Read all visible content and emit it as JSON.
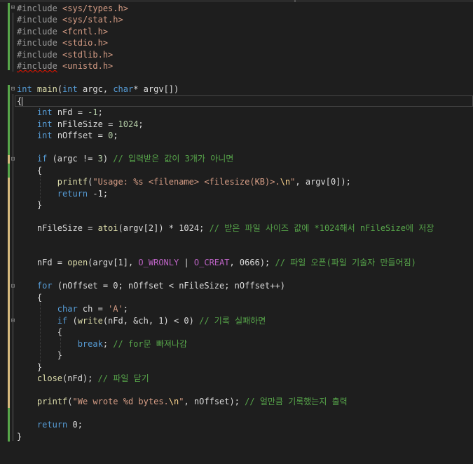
{
  "colors": {
    "background": "#1e1e1e",
    "keyword": "#569cd6",
    "string": "#d69d85",
    "comment": "#57a64a",
    "function": "#dcdcaa",
    "number": "#b5cea8",
    "variable": "#9cdcfe",
    "macro": "#bd63c5"
  },
  "code": {
    "includes": [
      {
        "directive": "#include",
        "header": "<sys/types.h>"
      },
      {
        "directive": "#include",
        "header": "<sys/stat.h>"
      },
      {
        "directive": "#include",
        "header": "<fcntl.h>"
      },
      {
        "directive": "#include",
        "header": "<stdio.h>"
      },
      {
        "directive": "#include",
        "header": "<stdlib.h>"
      },
      {
        "directive": "#include",
        "header": "<unistd.h>"
      }
    ],
    "main_signature": {
      "int": "int",
      "name": "main",
      "open": "(",
      "int2": "int",
      "p1": " argc, ",
      "char": "char",
      "p2": "* argv[])"
    },
    "open_brace": "{",
    "decl_fd": {
      "kw": "int",
      "rest": " nFd = ",
      "val": "-1",
      "end": ";"
    },
    "decl_size": {
      "kw": "int",
      "rest": " nFileSize = ",
      "val": "1024",
      "end": ";"
    },
    "decl_offset": {
      "kw": "int",
      "rest": " nOffset = ",
      "val": "0",
      "end": ";"
    },
    "if_argc": {
      "kw": "if",
      "rest": " (argc != ",
      "val": "3",
      "close": ") ",
      "comment": "// 입력받은 값이 3개가 아니면"
    },
    "if_open": "{",
    "printf_usage": {
      "fn": "printf",
      "open": "(",
      "str1": "\"Usage: %s <filename> <filesize(KB)>.",
      "esc": "\\n",
      "str2": "\"",
      "rest": ", argv[0]);"
    },
    "return_neg": {
      "kw": "return",
      "rest": " -1;"
    },
    "if_close": "}",
    "atoi_line": {
      "lhs": "nFileSize = ",
      "fn": "atoi",
      "rest": "(argv[2]) * 1024; ",
      "comment": "// 받은 파일 사이즈 값에 *1024해서 nFileSize에 저장"
    },
    "open_line": {
      "lhs": "nFd = ",
      "fn": "open",
      "p1": "(argv[1], ",
      "m1": "O_WRONLY",
      "p2": " | ",
      "m2": "O_CREAT",
      "p3": ", 0666); ",
      "comment": "// 파일 오픈(파일 기술자 만들어짐)"
    },
    "for_line": {
      "kw": "for",
      "rest": " (nOffset = 0; nOffset < nFileSize; nOffset++)"
    },
    "for_open": "{",
    "char_line": {
      "kw": "char",
      "rest": " ch = ",
      "str": "'A'",
      "end": ";"
    },
    "if_write": {
      "kw": "if",
      "p1": " (",
      "fn": "write",
      "rest": "(nFd, &ch, 1) < 0) ",
      "comment": "// 기록 실패하면"
    },
    "inner_open": "{",
    "break_line": {
      "kw": "break",
      "rest": "; ",
      "comment": "// for문 빠져나감"
    },
    "inner_close": "}",
    "for_close": "}",
    "close_line": {
      "fn": "close",
      "rest": "(nFd); ",
      "comment": "// 파일 닫기"
    },
    "printf_done": {
      "fn": "printf",
      "open": "(",
      "str1": "\"We wrote %d bytes.",
      "esc": "\\n",
      "str2": "\"",
      "rest": ", nOffset); ",
      "comment": "// 얼만큼 기록했는지 출력"
    },
    "return_zero": {
      "kw": "return",
      "rest": " 0;"
    },
    "close_brace": "}"
  }
}
